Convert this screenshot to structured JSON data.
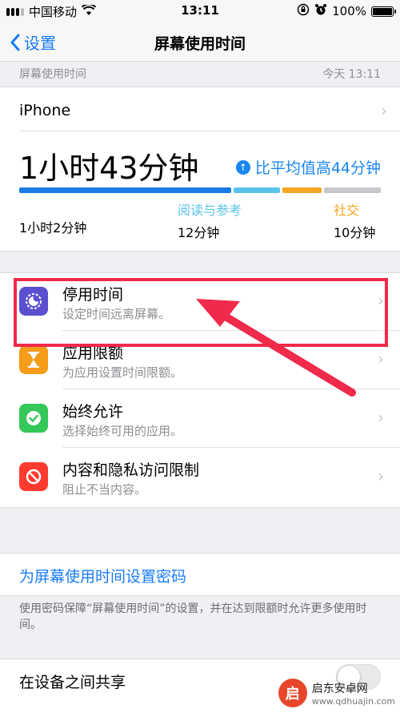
{
  "status_bar": {
    "carrier": "中国移动",
    "time": "13:11",
    "battery": "100%"
  },
  "nav": {
    "back_label": "设置",
    "title": "屏幕使用时间"
  },
  "section": {
    "label": "屏幕使用时间",
    "timestamp": "今天 13:11"
  },
  "summary": {
    "device": "iPhone",
    "total": "1小时43分钟",
    "comparison": "比平均值高44分钟",
    "bar_segments": [
      {
        "color": "#1a7be4",
        "fraction": 0.6
      },
      {
        "color": "#5ac2e8",
        "fraction": 0.13
      },
      {
        "color": "#f5a623",
        "fraction": 0.11
      },
      {
        "color": "#c7c7cc",
        "fraction": 0.16
      }
    ],
    "categories": [
      {
        "name": "",
        "value": "1小时2分钟",
        "color": "#000000"
      },
      {
        "name": "阅读与参考",
        "value": "12分钟",
        "color": "#5ac2e8"
      },
      {
        "name": "社交",
        "value": "10分钟",
        "color": "#f5a623"
      }
    ]
  },
  "settings": [
    {
      "title": "停用时间",
      "subtitle": "设定时间远离屏幕。",
      "icon": "moon-downtime-icon",
      "icon_color": "#5a4fcf"
    },
    {
      "title": "应用限额",
      "subtitle": "为应用设置时间限额。",
      "icon": "hourglass-icon",
      "icon_color": "#f59c1a"
    },
    {
      "title": "始终允许",
      "subtitle": "选择始终可用的应用。",
      "icon": "checkmark-badge-icon",
      "icon_color": "#34c759"
    },
    {
      "title": "内容和隐私访问限制",
      "subtitle": "阻止不当内容。",
      "icon": "no-entry-icon",
      "icon_color": "#ff3b30"
    }
  ],
  "passcode_link": "为屏幕使用时间设置密码",
  "passcode_footnote": "使用密码保障“屏幕使用时间”的设置，并在达到限额时允许更多使用时间。",
  "share": {
    "label": "在设备之间共享",
    "enabled": false
  },
  "watermark": {
    "name": "启东安卓网",
    "url": "www.qdhuajin.com"
  }
}
